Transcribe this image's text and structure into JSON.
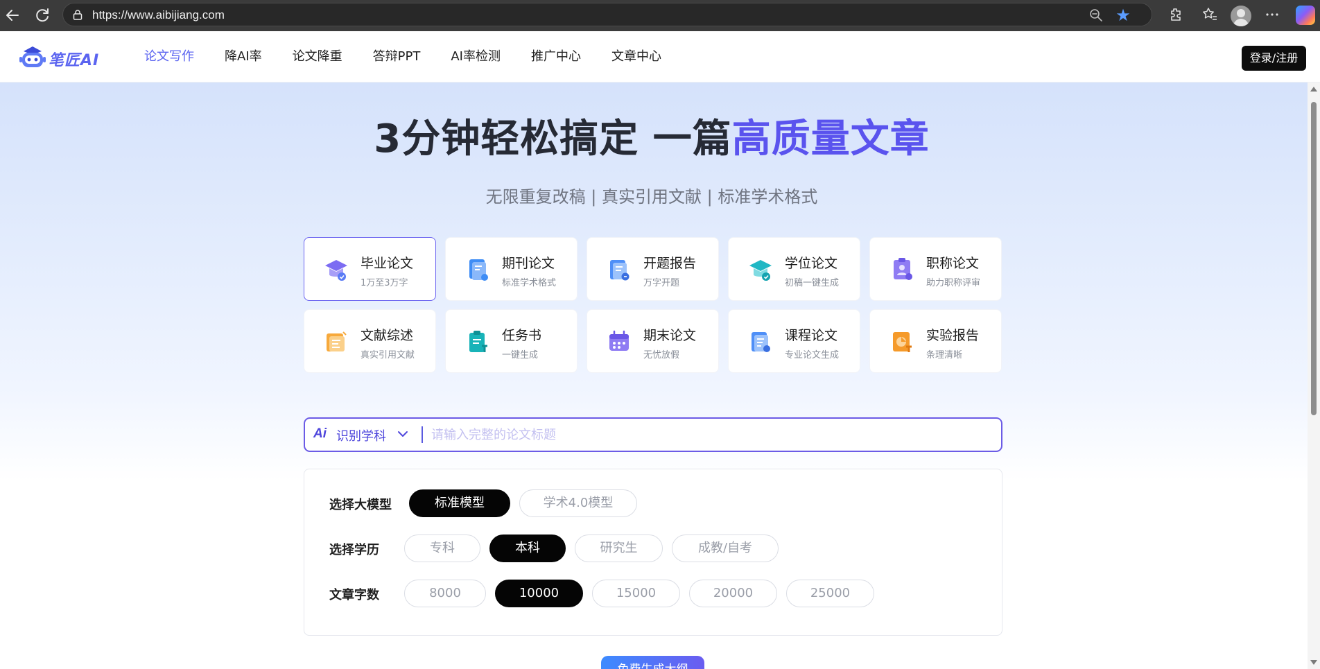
{
  "browser": {
    "url": "https://www.aibijiang.com"
  },
  "header": {
    "logo_text": "笔匠AI",
    "nav": [
      {
        "label": "论文写作",
        "active": true
      },
      {
        "label": "降AI率",
        "active": false
      },
      {
        "label": "论文降重",
        "active": false
      },
      {
        "label": "答辩PPT",
        "active": false
      },
      {
        "label": "AI率检测",
        "active": false
      },
      {
        "label": "推广中心",
        "active": false
      },
      {
        "label": "文章中心",
        "active": false
      }
    ],
    "login_label": "登录/注册"
  },
  "hero": {
    "title_main": "3分钟轻松搞定 一篇",
    "title_accent": "高质量文章",
    "subtitle": "无限重复改稿 | 真实引用文献 | 标准学术格式"
  },
  "cards": [
    {
      "title": "毕业论文",
      "desc": "1万至3万字",
      "icon": "graduation-cap-icon",
      "active": true
    },
    {
      "title": "期刊论文",
      "desc": "标准学术格式",
      "icon": "journal-book-icon"
    },
    {
      "title": "开题报告",
      "desc": "万字开题",
      "icon": "proposal-doc-icon"
    },
    {
      "title": "学位论文",
      "desc": "初稿一键生成",
      "icon": "degree-cap-icon"
    },
    {
      "title": "职称论文",
      "desc": "助力职称评审",
      "icon": "title-badge-icon"
    },
    {
      "title": "文献综述",
      "desc": "真实引用文献",
      "icon": "literature-doc-icon"
    },
    {
      "title": "任务书",
      "desc": "一键生成",
      "icon": "task-clipboard-icon"
    },
    {
      "title": "期末论文",
      "desc": "无忧放假",
      "icon": "calendar-icon"
    },
    {
      "title": "课程论文",
      "desc": "专业论文生成",
      "icon": "course-doc-icon"
    },
    {
      "title": "实验报告",
      "desc": "条理清晰",
      "icon": "lab-report-icon"
    }
  ],
  "search": {
    "ai_label": "Ai",
    "subject_label": "识别学科",
    "placeholder": "请输入完整的论文标题"
  },
  "options": {
    "model": {
      "label": "选择大模型",
      "choices": [
        "标准模型",
        "学术4.0模型"
      ],
      "selected": "标准模型"
    },
    "education": {
      "label": "选择学历",
      "choices": [
        "专科",
        "本科",
        "研究生",
        "成教/自考"
      ],
      "selected": "本科"
    },
    "word_count": {
      "label": "文章字数",
      "choices": [
        "8000",
        "10000",
        "15000",
        "20000",
        "25000"
      ],
      "selected": "10000"
    }
  },
  "generate_label": "免费生成大纲",
  "colors": {
    "accent": "#5a53ee",
    "chrome_bg": "#3b3b3b",
    "selected_pill": "#050505"
  }
}
